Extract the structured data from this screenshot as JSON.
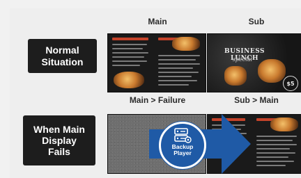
{
  "columns": {
    "main_label": "Main",
    "sub_label": "Sub",
    "main_failure_label": "Main > Failure",
    "sub_main_label": "Sub > Main"
  },
  "rows": {
    "normal_label": "Normal Situation",
    "fails_label": "When Main Display Fails"
  },
  "screens": {
    "sub_title": "BUSINESS LUNCH",
    "sub_script": "special",
    "sub_price": "$5"
  },
  "backup_player": {
    "label": "Backup Player",
    "icon": "server-icon"
  },
  "colors": {
    "accent_blue": "#1f5aa6",
    "label_bg": "#1d1d1d",
    "menu_red": "#c4432a"
  }
}
